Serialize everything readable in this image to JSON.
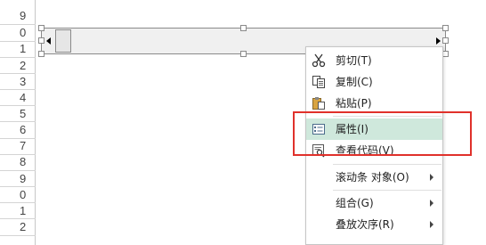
{
  "row_numbers": [
    "9",
    "0",
    "1",
    "2",
    "3",
    "4",
    "5",
    "6",
    "7",
    "8",
    "9",
    "0",
    "1",
    "2"
  ],
  "scrollbar": {
    "left_arrow": "◂",
    "right_arrow": "▸"
  },
  "context_menu": {
    "items": [
      {
        "label": "剪切(T)",
        "icon": "scissors-icon"
      },
      {
        "label": "复制(C)",
        "icon": "copy-icon"
      },
      {
        "label": "粘贴(P)",
        "icon": "paste-icon"
      },
      {
        "label": "属性(I)",
        "icon": "properties-icon"
      },
      {
        "label": "查看代码(V)",
        "icon": "view-code-icon"
      },
      {
        "label": "滚动条 对象(O)",
        "has_submenu": true
      },
      {
        "label": "组合(G)",
        "has_submenu": true
      },
      {
        "label": "叠放次序(R)",
        "has_submenu": true
      }
    ]
  },
  "colors": {
    "highlight": "#cfe8dc",
    "annotation_box": "#e0312b"
  }
}
